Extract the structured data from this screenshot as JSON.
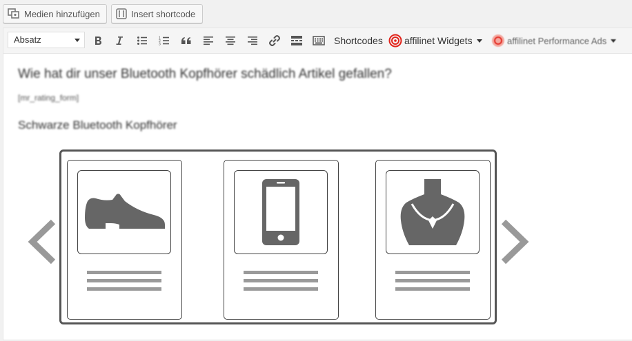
{
  "media_buttons": {
    "add_media": "Medien hinzufügen",
    "insert_shortcode": "Insert shortcode"
  },
  "toolbar": {
    "format_value": "Absatz",
    "shortcodes": "Shortcodes",
    "affilinet_widgets": "affilinet Widgets",
    "affilinet_ads": "affilinet Performance Ads"
  },
  "content": {
    "heading": "Wie hat dir unser Bluetooth Kopfhörer schädlich Artikel gefallen?",
    "shortcode": "[mr_rating_form]",
    "subheading": "Schwarze Bluetooth Kopfhörer"
  },
  "carousel": {
    "items": [
      {
        "icon": "shoe-icon"
      },
      {
        "icon": "smartphone-icon"
      },
      {
        "icon": "necklace-icon"
      }
    ]
  },
  "colors": {
    "icon_gray": "#666666",
    "affilinet_red": "#e2231a",
    "arrow_gray": "#999999"
  }
}
